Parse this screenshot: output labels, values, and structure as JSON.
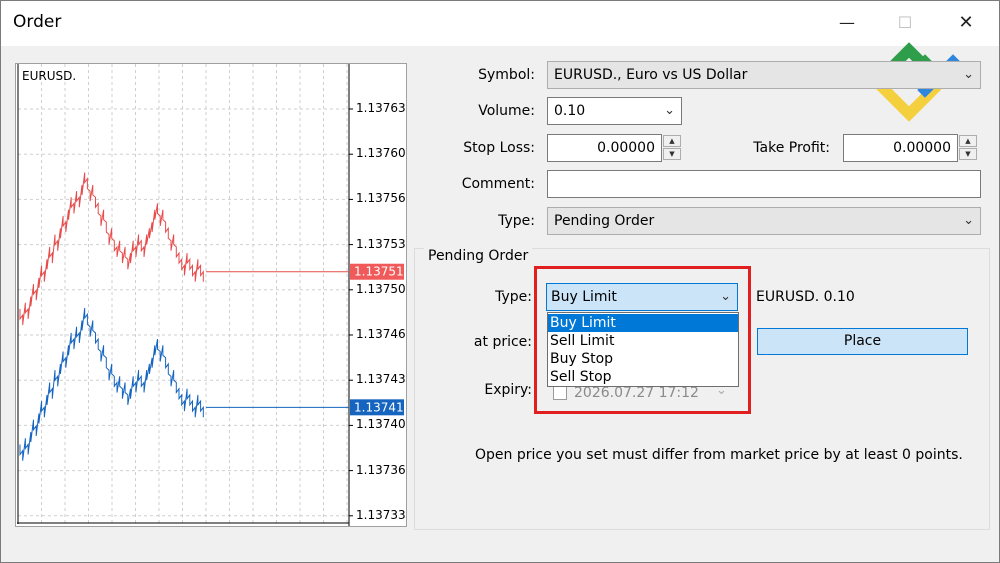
{
  "window": {
    "title": "Order",
    "minimize_glyph": "—",
    "maximize_glyph": "☐",
    "close_glyph": "✕"
  },
  "chart": {
    "symbol_label": "EURUSD.",
    "price_levels": [
      "1.13763",
      "1.13760",
      "1.13756",
      "1.13753",
      "1.13750",
      "1.13746",
      "1.13743",
      "1.13740",
      "1.13736",
      "1.13733"
    ],
    "ask_price": "1.13751",
    "bid_price": "1.13741",
    "colors": {
      "ask": "#e74c4c",
      "bid": "#1565c0",
      "ask_tag": "#f05a5a",
      "bid_tag": "#1565c0"
    }
  },
  "form": {
    "symbol_label": "Symbol:",
    "symbol_value": "EURUSD., Euro vs US Dollar",
    "volume_label": "Volume:",
    "volume_value": "0.10",
    "stop_loss_label": "Stop Loss:",
    "stop_loss_value": "0.00000",
    "take_profit_label": "Take Profit:",
    "take_profit_value": "0.00000",
    "comment_label": "Comment:",
    "comment_value": "",
    "type_label": "Type:",
    "type_value": "Pending Order"
  },
  "pending": {
    "group_title": "Pending Order",
    "type_label": "Type:",
    "type_value": "Buy Limit",
    "type_options": [
      "Buy Limit",
      "Sell Limit",
      "Buy Stop",
      "Sell Stop"
    ],
    "selected_option": "Buy Limit",
    "symbol_volume_text": "EURUSD. 0.10",
    "at_price_label": "at price:",
    "place_button": "Place",
    "expiry_label": "Expiry:",
    "expiry_value": "2026.07.27 17:12",
    "note": "Open price you set must differ from market price by at least 0 points."
  },
  "highlight_color": "#e02020",
  "logo": {
    "name": "brand-logo",
    "colors": [
      "#2e9e4a",
      "#2e86de",
      "#f4d03f"
    ]
  }
}
